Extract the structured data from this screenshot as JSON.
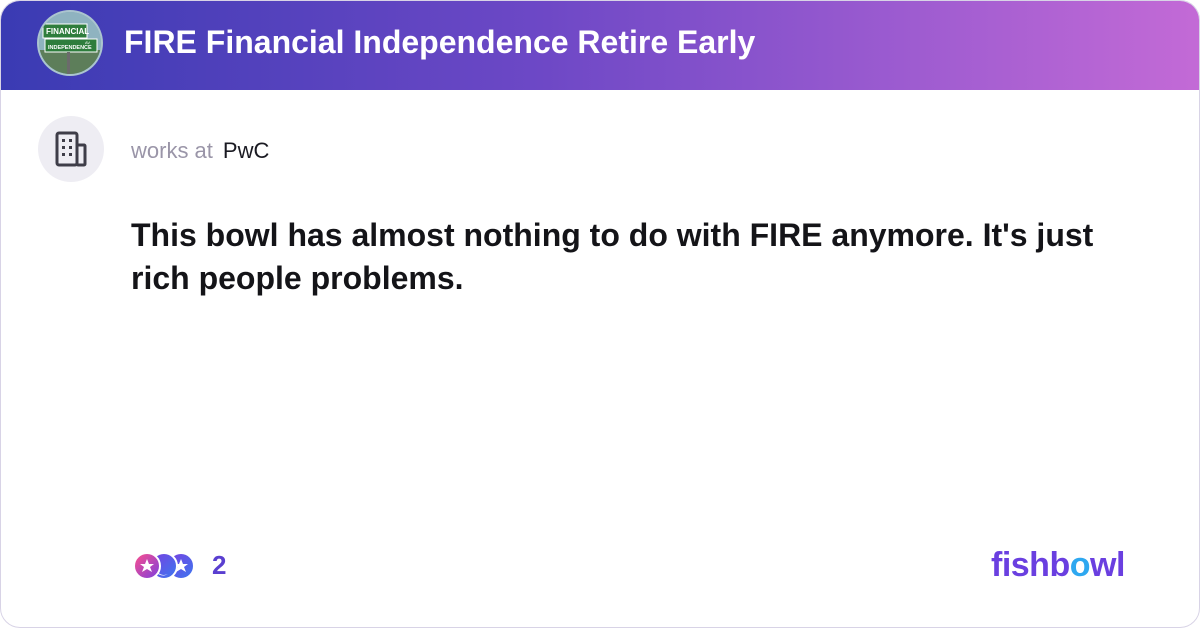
{
  "header": {
    "bowl_title": "FIRE Financial Independence Retire Early",
    "avatar_sign_line1": "FINANCIAL",
    "avatar_sign_line2": "INDEPENDENCE",
    "avatar_sign_small": "AV"
  },
  "author": {
    "works_at_label": "works at",
    "company": "PwC",
    "avatar_icon": "building-icon"
  },
  "post": {
    "text": "This bowl has almost nothing to do with FIRE anymore. It's just rich people problems."
  },
  "reactions": {
    "icons": [
      "reaction-icon-1",
      "reaction-icon-2",
      "reaction-icon-3"
    ],
    "count": "2"
  },
  "brand": {
    "logo_part1": "fishb",
    "logo_part2": "o",
    "logo_part3": "wl"
  },
  "colors": {
    "header_start": "#3a3bb3",
    "header_end": "#c36ad6",
    "accent": "#5a3fd0",
    "logo_purple": "#6a3fe0",
    "logo_blue": "#2ea8f0"
  }
}
